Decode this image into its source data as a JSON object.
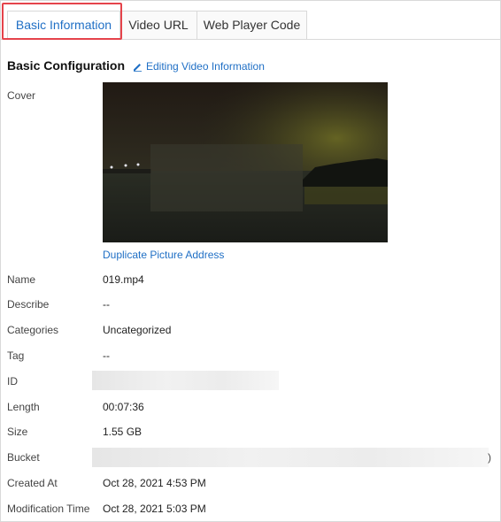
{
  "tabs": [
    {
      "label": "Basic Information",
      "active": true
    },
    {
      "label": "Video URL",
      "active": false
    },
    {
      "label": "Web Player Code",
      "active": false
    }
  ],
  "section": {
    "title": "Basic Configuration",
    "edit_label": "Editing Video Information"
  },
  "cover": {
    "label": "Cover",
    "duplicate_label": "Duplicate Picture Address"
  },
  "fields": {
    "name": {
      "label": "Name",
      "value": "019.mp4"
    },
    "describe": {
      "label": "Describe",
      "value": "--"
    },
    "categories": {
      "label": "Categories",
      "value": "Uncategorized"
    },
    "tag": {
      "label": "Tag",
      "value": "--"
    },
    "id": {
      "label": "ID"
    },
    "length": {
      "label": "Length",
      "value": "00:07:36"
    },
    "size": {
      "label": "Size",
      "value": "1.55 GB"
    },
    "bucket": {
      "label": "Bucket",
      "tail": ")"
    },
    "created": {
      "label": "Created At",
      "value": "Oct 28, 2021 4:53 PM"
    },
    "modified": {
      "label": "Modification Time",
      "value": "Oct 28, 2021 5:03 PM"
    }
  },
  "colors": {
    "accent": "#1f6fc5",
    "highlight": "#e5434b"
  }
}
